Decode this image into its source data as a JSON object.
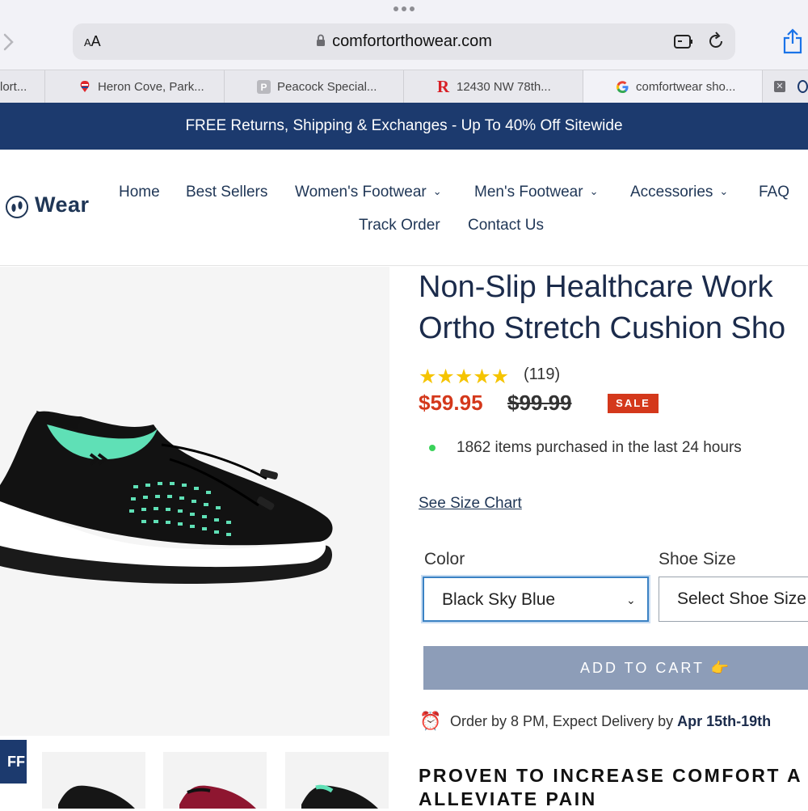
{
  "browser": {
    "address_aa": "AA",
    "url": "comfortorthowear.com",
    "tabs": [
      {
        "label": "lort...",
        "icon": "page-favicon"
      },
      {
        "label": "Heron Cove, Park...",
        "icon": "remax-balloon-icon"
      },
      {
        "label": "Peacock Special...",
        "icon": "p-letter-icon"
      },
      {
        "label": "12430 NW 78th...",
        "icon": "r-letter-icon"
      },
      {
        "label": "comfortwear sho...",
        "icon": "google-g-icon"
      }
    ]
  },
  "promo_bar": {
    "text": "FREE Returns, Shipping & Exchanges - Up To 40% Off Sitewide"
  },
  "header": {
    "logo_text": "Wear",
    "nav": [
      {
        "label": "Home",
        "dropdown": false
      },
      {
        "label": "Best Sellers",
        "dropdown": false
      },
      {
        "label": "Women's Footwear",
        "dropdown": true
      },
      {
        "label": "Men's Footwear",
        "dropdown": true
      },
      {
        "label": "Accessories",
        "dropdown": true
      },
      {
        "label": "FAQ",
        "dropdown": false
      },
      {
        "label": "Track Order",
        "dropdown": false
      },
      {
        "label": "Contact Us",
        "dropdown": false
      }
    ]
  },
  "product": {
    "title_line1": "Non-Slip Healthcare Work",
    "title_line2": "Ortho Stretch Cushion Sho",
    "rating": 5,
    "reviews": "(119)",
    "price": "$59.95",
    "compare_price": "$99.99",
    "badge": "SALE",
    "purchased_text": "1862 items purchased in the last 24 hours",
    "size_chart_link": "See Size Chart",
    "color_label": "Color",
    "color_value": "Black Sky Blue",
    "size_label": "Shoe Size",
    "size_value": "Select Shoe Size",
    "add_to_cart": "ADD TO CART 👉",
    "delivery_prefix": "Order by 8 PM, Expect Delivery by ",
    "delivery_dates": "Apr 15th-19th",
    "proven_line1": "PROVEN TO INCREASE COMFORT A",
    "proven_line2": "ALLEVIATE PAIN"
  },
  "floating_tab": {
    "text": "FF"
  },
  "colors": {
    "brand_navy": "#1c3a6e",
    "sale_red": "#d4381b",
    "star_yellow": "#f5c400",
    "cart_button": "#8d9db8",
    "mint": "#5fe0b6"
  }
}
